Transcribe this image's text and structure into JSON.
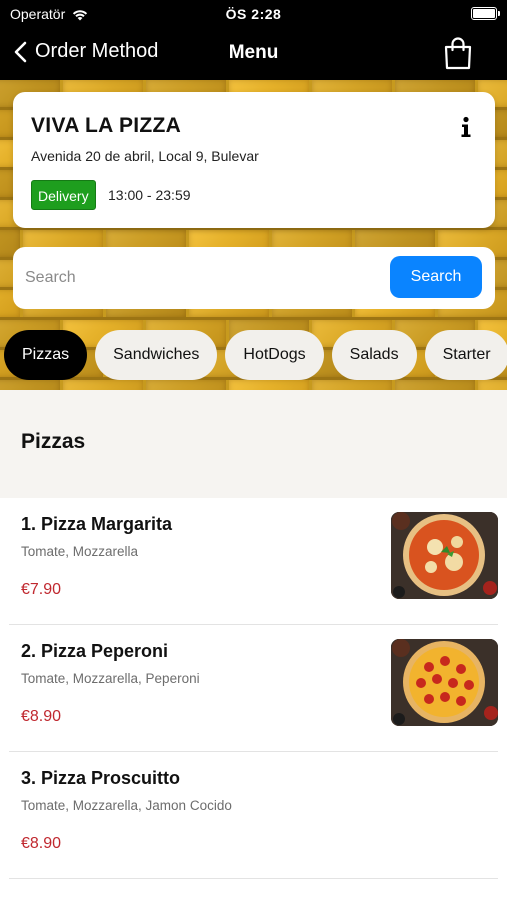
{
  "status_bar": {
    "carrier": "Operatör",
    "time": "ÖS 2:28"
  },
  "nav": {
    "back_label": "Order Method",
    "title": "Menu",
    "cart_icon": "shopping-bag-icon"
  },
  "restaurant": {
    "name": "VIVA LA PIZZA",
    "address": "Avenida 20 de abril, Local 9, Bulevar",
    "badge": "Delivery",
    "hours": "13:00 - 23:59",
    "info_icon": "info-icon"
  },
  "search": {
    "placeholder": "Search",
    "value": "",
    "button_label": "Search"
  },
  "categories": [
    "Pizzas",
    "Sandwiches",
    "HotDogs",
    "Salads",
    "Starter"
  ],
  "active_category": "Pizzas",
  "section": {
    "title": "Pizzas"
  },
  "items": [
    {
      "name": "1. Pizza Margarita",
      "description": "Tomate, Mozzarella",
      "price": "€7.90",
      "image": "pizza-margarita"
    },
    {
      "name": "2. Pizza Peperoni",
      "description": "Tomate, Mozzarella, Peperoni",
      "price": "€8.90",
      "image": "pizza-pepperoni"
    },
    {
      "name": "3. Pizza Proscuitto",
      "description": "Tomate, Mozzarella, Jamon Cocido",
      "price": "€8.90",
      "image": ""
    }
  ],
  "colors": {
    "accent_blue": "#0a84ff",
    "delivery_green": "#1e9e1e",
    "price_red": "#c0282f",
    "brick_yellow": "#d4a427"
  }
}
